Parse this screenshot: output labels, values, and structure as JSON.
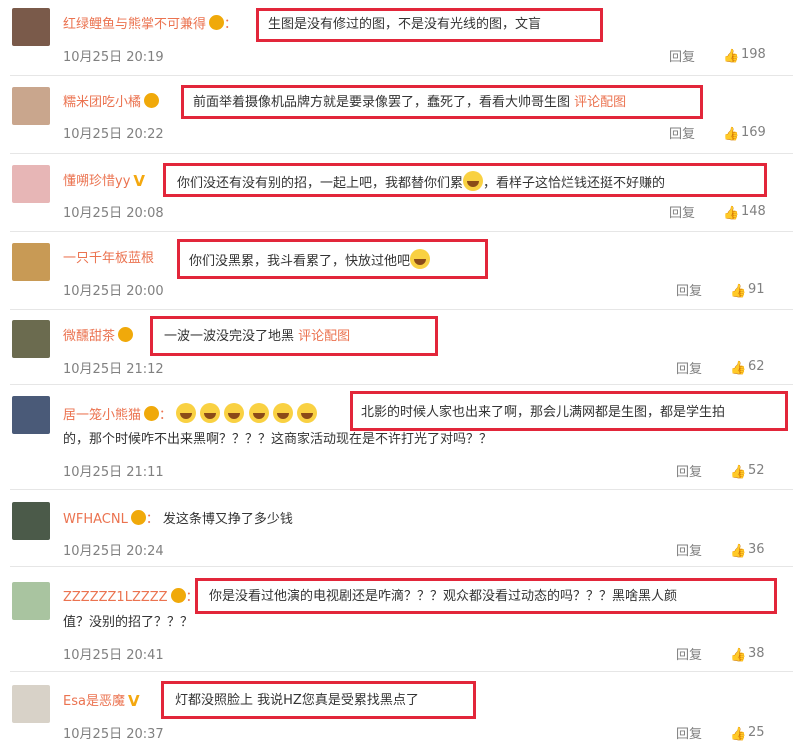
{
  "comments": [
    {
      "user": "红绿鲤鱼与熊掌不可兼得",
      "badge": "gold",
      "text": "生图是没有修过的图，不是没有光线的图，文盲",
      "link": "",
      "time": "10月25日 20:19",
      "reply": "回复",
      "likes": "198",
      "avatar": "#7a5a4a"
    },
    {
      "user": "糯米团吃小橘",
      "badge": "gold",
      "text": "前面举着摄像机品牌方就是要录像罢了，蠢死了，看看大帅哥生图",
      "link": "评论配图",
      "time": "10月25日 20:22",
      "reply": "回复",
      "likes": "169",
      "avatar": "#c9a68d"
    },
    {
      "user": "懂嗍珍惜yy",
      "badge": "vip",
      "text": "你们没还有没有别的招，一起上吧，我都替你们累",
      "text2": "，看样子这恰烂钱还挺不好赚的",
      "link": "",
      "time": "10月25日 20:08",
      "reply": "回复",
      "likes": "148",
      "avatar": "#e7b6b6"
    },
    {
      "user": "一只千年板蓝根",
      "badge": "",
      "text": "你们没黑累，我斗看累了，快放过他吧",
      "link": "",
      "time": "10月25日 20:00",
      "reply": "回复",
      "likes": "91",
      "avatar": "#c89a55"
    },
    {
      "user": "微醺甜茶",
      "badge": "gold",
      "text": "一波一波没完没了地黑",
      "link": "评论配图",
      "time": "10月25日 21:12",
      "reply": "回复",
      "likes": "62",
      "avatar": "#6b6b4f"
    },
    {
      "user": "居一笼小熊猫",
      "badge": "gold",
      "text": "北影的时候人家也出来了啊，那会儿满网都是生图，都是学生拍",
      "text2": "的，那个时候咋不出来黑啊？？？？这商家活动现在是不许打光了对吗？？",
      "link": "",
      "time": "10月25日 21:11",
      "reply": "回复",
      "likes": "52",
      "avatar": "#4a5a78"
    },
    {
      "user": "WFHACNL",
      "badge": "gold",
      "text": "发这条博又挣了多少钱",
      "link": "",
      "time": "10月25日 20:24",
      "reply": "回复",
      "likes": "36",
      "avatar": "#4b5a49"
    },
    {
      "user": "ZZZZZZ1LZZZZ",
      "badge": "gold",
      "text": "你是没看过他演的电视剧还是咋滴？？？观众都没看过动态的吗？？？黑啥黑人颜",
      "text2": "值？没别的招了？？？",
      "link": "",
      "time": "10月25日 20:41",
      "reply": "回复",
      "likes": "38",
      "avatar": "#a9c4a0"
    },
    {
      "user": "Esa是恶魔",
      "badge": "vip",
      "text": "灯都没照脸上 我说HZ您真是受累找黑点了",
      "link": "",
      "time": "10月25日 20:37",
      "reply": "回复",
      "likes": "25",
      "avatar": "#d8d2c8"
    }
  ]
}
